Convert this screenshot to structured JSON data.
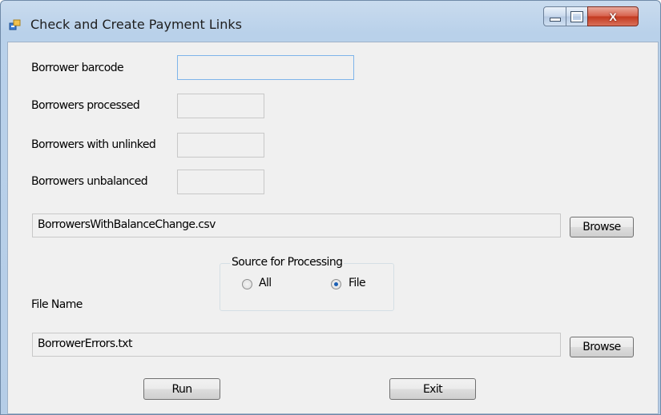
{
  "window": {
    "title": "Check and Create Payment Links",
    "icon": "app-window-icon",
    "controls": {
      "minimize": "minimize-icon",
      "maximize": "maximize-icon",
      "close": "x"
    }
  },
  "form": {
    "borrower_barcode": {
      "label": "Borrower barcode",
      "value": ""
    },
    "borrowers_processed": {
      "label": "Borrowers processed",
      "value": ""
    },
    "borrowers_unlinked": {
      "label": "Borrowers with unlinked",
      "value": ""
    },
    "borrowers_unbalanced": {
      "label": "Borrowers unbalanced",
      "value": ""
    },
    "input_file": {
      "value": "BorrowersWithBalanceChange.csv",
      "browse_label": "Browse"
    },
    "source": {
      "title": "Source for Processing",
      "options": [
        "All",
        "File"
      ],
      "selected": "File"
    },
    "file_name_label": "File Name",
    "error_file": {
      "value": "BorrowerErrors.txt",
      "browse_label": "Browse"
    },
    "run_label": "Run",
    "exit_label": "Exit"
  },
  "colors": {
    "accent": "#1b5fb4",
    "close_button": "#c2381e",
    "client_bg": "#f0f0f0"
  }
}
